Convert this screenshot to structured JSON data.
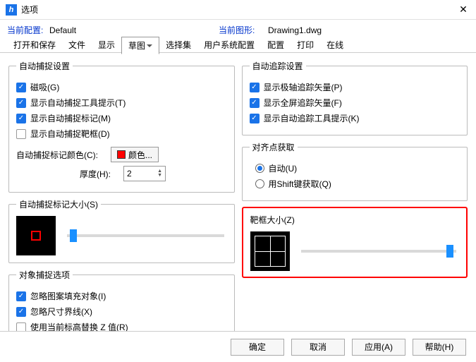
{
  "window": {
    "title": "选项"
  },
  "config": {
    "current_config_label": "当前配置:",
    "current_config_value": "Default",
    "current_drawing_label": "当前图形:",
    "current_drawing_value": "Drawing1.dwg"
  },
  "tabs": {
    "open_save": "打开和保存",
    "file": "文件",
    "display": "显示",
    "sketch": "草图",
    "selection": "选择集",
    "user_sys": "用户系统配置",
    "config": "配置",
    "print": "打印",
    "online": "在线"
  },
  "autosnap": {
    "legend": "自动捕捉设置",
    "magnet": "磁吸(G)",
    "tooltip": "显示自动捕捉工具提示(T)",
    "marker": "显示自动捕捉标记(M)",
    "targetbox": "显示自动捕捉靶框(D)",
    "marker_color_label": "自动捕捉标记颜色(C):",
    "color_btn": "颜色...",
    "thickness_label": "厚度(H):",
    "thickness_value": "2"
  },
  "autotrack": {
    "legend": "自动追踪设置",
    "polar": "显示极轴追踪矢量(P)",
    "fullscreen": "显示全屏追踪矢量(F)",
    "tooltip": "显示自动追踪工具提示(K)"
  },
  "alignment": {
    "legend": "对齐点获取",
    "auto": "自动(U)",
    "shift": "用Shift键获取(Q)"
  },
  "marker_size": {
    "legend": "自动捕捉标记大小(S)"
  },
  "target_size": {
    "legend": "靶框大小(Z)"
  },
  "object_snap": {
    "legend": "对象捕捉选项",
    "ignore_hatch": "忽略图案填充对象(I)",
    "ignore_dim": "忽略尺寸界线(X)",
    "replace_z": "使用当前标高替换 Z 值(R)"
  },
  "buttons": {
    "ok": "确定",
    "cancel": "取消",
    "apply": "应用(A)",
    "help": "帮助(H)"
  }
}
